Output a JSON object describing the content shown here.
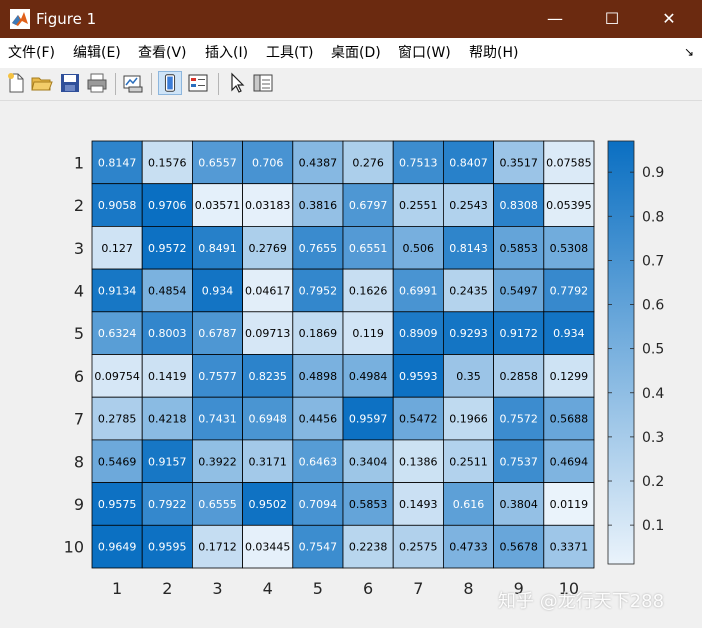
{
  "window": {
    "title": "Figure 1",
    "controls": {
      "minimize": "—",
      "maximize": "☐",
      "close": "✕"
    }
  },
  "menubar": {
    "items": [
      "文件(F)",
      "编辑(E)",
      "查看(V)",
      "插入(I)",
      "工具(T)",
      "桌面(D)",
      "窗口(W)",
      "帮助(H)"
    ],
    "dock_arrow": "↘"
  },
  "toolbar": {
    "buttons": [
      "new-figure",
      "open-file",
      "save",
      "print",
      "link-plot",
      "insert-colorbar",
      "insert-legend",
      "select-pointer",
      "property-inspector"
    ]
  },
  "watermark": "知乎 @龙行天下288",
  "colors": {
    "titlebar": "#6b2a10",
    "low": "#eaf3fb",
    "high": "#0a6fc2",
    "grid_line": "#000000"
  },
  "chart_data": {
    "type": "heatmap",
    "x_tick_labels": [
      "1",
      "2",
      "3",
      "4",
      "5",
      "6",
      "7",
      "8",
      "9",
      "10"
    ],
    "y_tick_labels": [
      "1",
      "2",
      "3",
      "4",
      "5",
      "6",
      "7",
      "8",
      "9",
      "10"
    ],
    "cell_labels": [
      [
        "0.8147",
        "0.1576",
        "0.6557",
        "0.706",
        "0.4387",
        "0.276",
        "0.7513",
        "0.8407",
        "0.3517",
        "0.07585"
      ],
      [
        "0.9058",
        "0.9706",
        "0.03571",
        "0.03183",
        "0.3816",
        "0.6797",
        "0.2551",
        "0.2543",
        "0.8308",
        "0.05395"
      ],
      [
        "0.127",
        "0.9572",
        "0.8491",
        "0.2769",
        "0.7655",
        "0.6551",
        "0.506",
        "0.8143",
        "0.5853",
        "0.5308"
      ],
      [
        "0.9134",
        "0.4854",
        "0.934",
        "0.04617",
        "0.7952",
        "0.1626",
        "0.6991",
        "0.2435",
        "0.5497",
        "0.7792"
      ],
      [
        "0.6324",
        "0.8003",
        "0.6787",
        "0.09713",
        "0.1869",
        "0.119",
        "0.8909",
        "0.9293",
        "0.9172",
        "0.934"
      ],
      [
        "0.09754",
        "0.1419",
        "0.7577",
        "0.8235",
        "0.4898",
        "0.4984",
        "0.9593",
        "0.35",
        "0.2858",
        "0.1299"
      ],
      [
        "0.2785",
        "0.4218",
        "0.7431",
        "0.6948",
        "0.4456",
        "0.9597",
        "0.5472",
        "0.1966",
        "0.7572",
        "0.5688"
      ],
      [
        "0.5469",
        "0.9157",
        "0.3922",
        "0.3171",
        "0.6463",
        "0.3404",
        "0.1386",
        "0.2511",
        "0.7537",
        "0.4694"
      ],
      [
        "0.9575",
        "0.7922",
        "0.6555",
        "0.9502",
        "0.7094",
        "0.5853",
        "0.1493",
        "0.616",
        "0.3804",
        "0.0119"
      ],
      [
        "0.9649",
        "0.9595",
        "0.1712",
        "0.03445",
        "0.7547",
        "0.2238",
        "0.2575",
        "0.4733",
        "0.5678",
        "0.3371"
      ]
    ],
    "color_limits": [
      0.0119,
      0.9706
    ],
    "colorbar_ticks": [
      "0.1",
      "0.2",
      "0.3",
      "0.4",
      "0.5",
      "0.6",
      "0.7",
      "0.8",
      "0.9"
    ],
    "colormap": [
      "#eaf3fb",
      "#0a6fc2"
    ],
    "grid": true,
    "colorbar_location": "right"
  }
}
